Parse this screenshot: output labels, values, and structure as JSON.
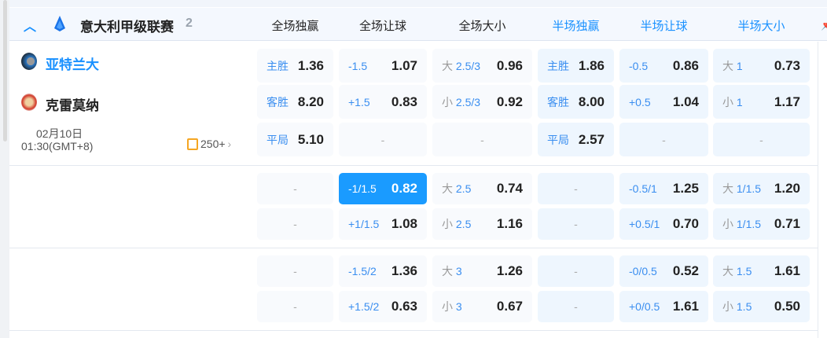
{
  "league": {
    "name": "意大利甲级联赛",
    "count": "2"
  },
  "columns": [
    {
      "label": "全场独赢",
      "color": "#222222"
    },
    {
      "label": "全场让球",
      "color": "#222222"
    },
    {
      "label": "全场大小",
      "color": "#222222"
    },
    {
      "label": "半场独赢",
      "color": "#1890ff"
    },
    {
      "label": "半场让球",
      "color": "#1890ff"
    },
    {
      "label": "半场大小",
      "color": "#1890ff"
    }
  ],
  "match": {
    "home": "亚特兰大",
    "away": "克雷莫纳",
    "date": "02月10日",
    "time": "01:30(GMT+8)",
    "markets_count": "250+"
  },
  "rows": [
    [
      {
        "pre": "",
        "lab": "主胜",
        "val": "1.36"
      },
      {
        "pre": "",
        "lab": "-1.5",
        "val": "1.07"
      },
      {
        "pre": "大",
        "lab": "2.5/3",
        "val": "0.96"
      },
      {
        "pre": "",
        "lab": "主胜",
        "val": "1.86"
      },
      {
        "pre": "",
        "lab": "-0.5",
        "val": "0.86"
      },
      {
        "pre": "大",
        "lab": "1",
        "val": "0.73"
      }
    ],
    [
      {
        "pre": "",
        "lab": "客胜",
        "val": "8.20"
      },
      {
        "pre": "",
        "lab": "+1.5",
        "val": "0.83"
      },
      {
        "pre": "小",
        "lab": "2.5/3",
        "val": "0.92"
      },
      {
        "pre": "",
        "lab": "客胜",
        "val": "8.00"
      },
      {
        "pre": "",
        "lab": "+0.5",
        "val": "1.04"
      },
      {
        "pre": "小",
        "lab": "1",
        "val": "1.17"
      }
    ],
    [
      {
        "pre": "",
        "lab": "平局",
        "val": "5.10"
      },
      null,
      null,
      {
        "pre": "",
        "lab": "平局",
        "val": "2.57"
      },
      null,
      null
    ],
    [
      null,
      {
        "pre": "",
        "lab": "-1/1.5",
        "val": "0.82",
        "selected": true
      },
      {
        "pre": "大",
        "lab": "2.5",
        "val": "0.74"
      },
      null,
      {
        "pre": "",
        "lab": "-0.5/1",
        "val": "1.25"
      },
      {
        "pre": "大",
        "lab": "1/1.5",
        "val": "1.20"
      }
    ],
    [
      null,
      {
        "pre": "",
        "lab": "+1/1.5",
        "val": "1.08"
      },
      {
        "pre": "小",
        "lab": "2.5",
        "val": "1.16"
      },
      null,
      {
        "pre": "",
        "lab": "+0.5/1",
        "val": "0.70"
      },
      {
        "pre": "小",
        "lab": "1/1.5",
        "val": "0.71"
      }
    ],
    [
      null,
      {
        "pre": "",
        "lab": "-1.5/2",
        "val": "1.36"
      },
      {
        "pre": "大",
        "lab": "3",
        "val": "1.26"
      },
      null,
      {
        "pre": "",
        "lab": "-0/0.5",
        "val": "0.52"
      },
      {
        "pre": "大",
        "lab": "1.5",
        "val": "1.61"
      }
    ],
    [
      null,
      {
        "pre": "",
        "lab": "+1.5/2",
        "val": "0.63"
      },
      {
        "pre": "小",
        "lab": "3",
        "val": "0.67"
      },
      null,
      {
        "pre": "",
        "lab": "+0/0.5",
        "val": "1.61"
      },
      {
        "pre": "小",
        "lab": "1.5",
        "val": "0.50"
      }
    ]
  ],
  "empty": "-"
}
